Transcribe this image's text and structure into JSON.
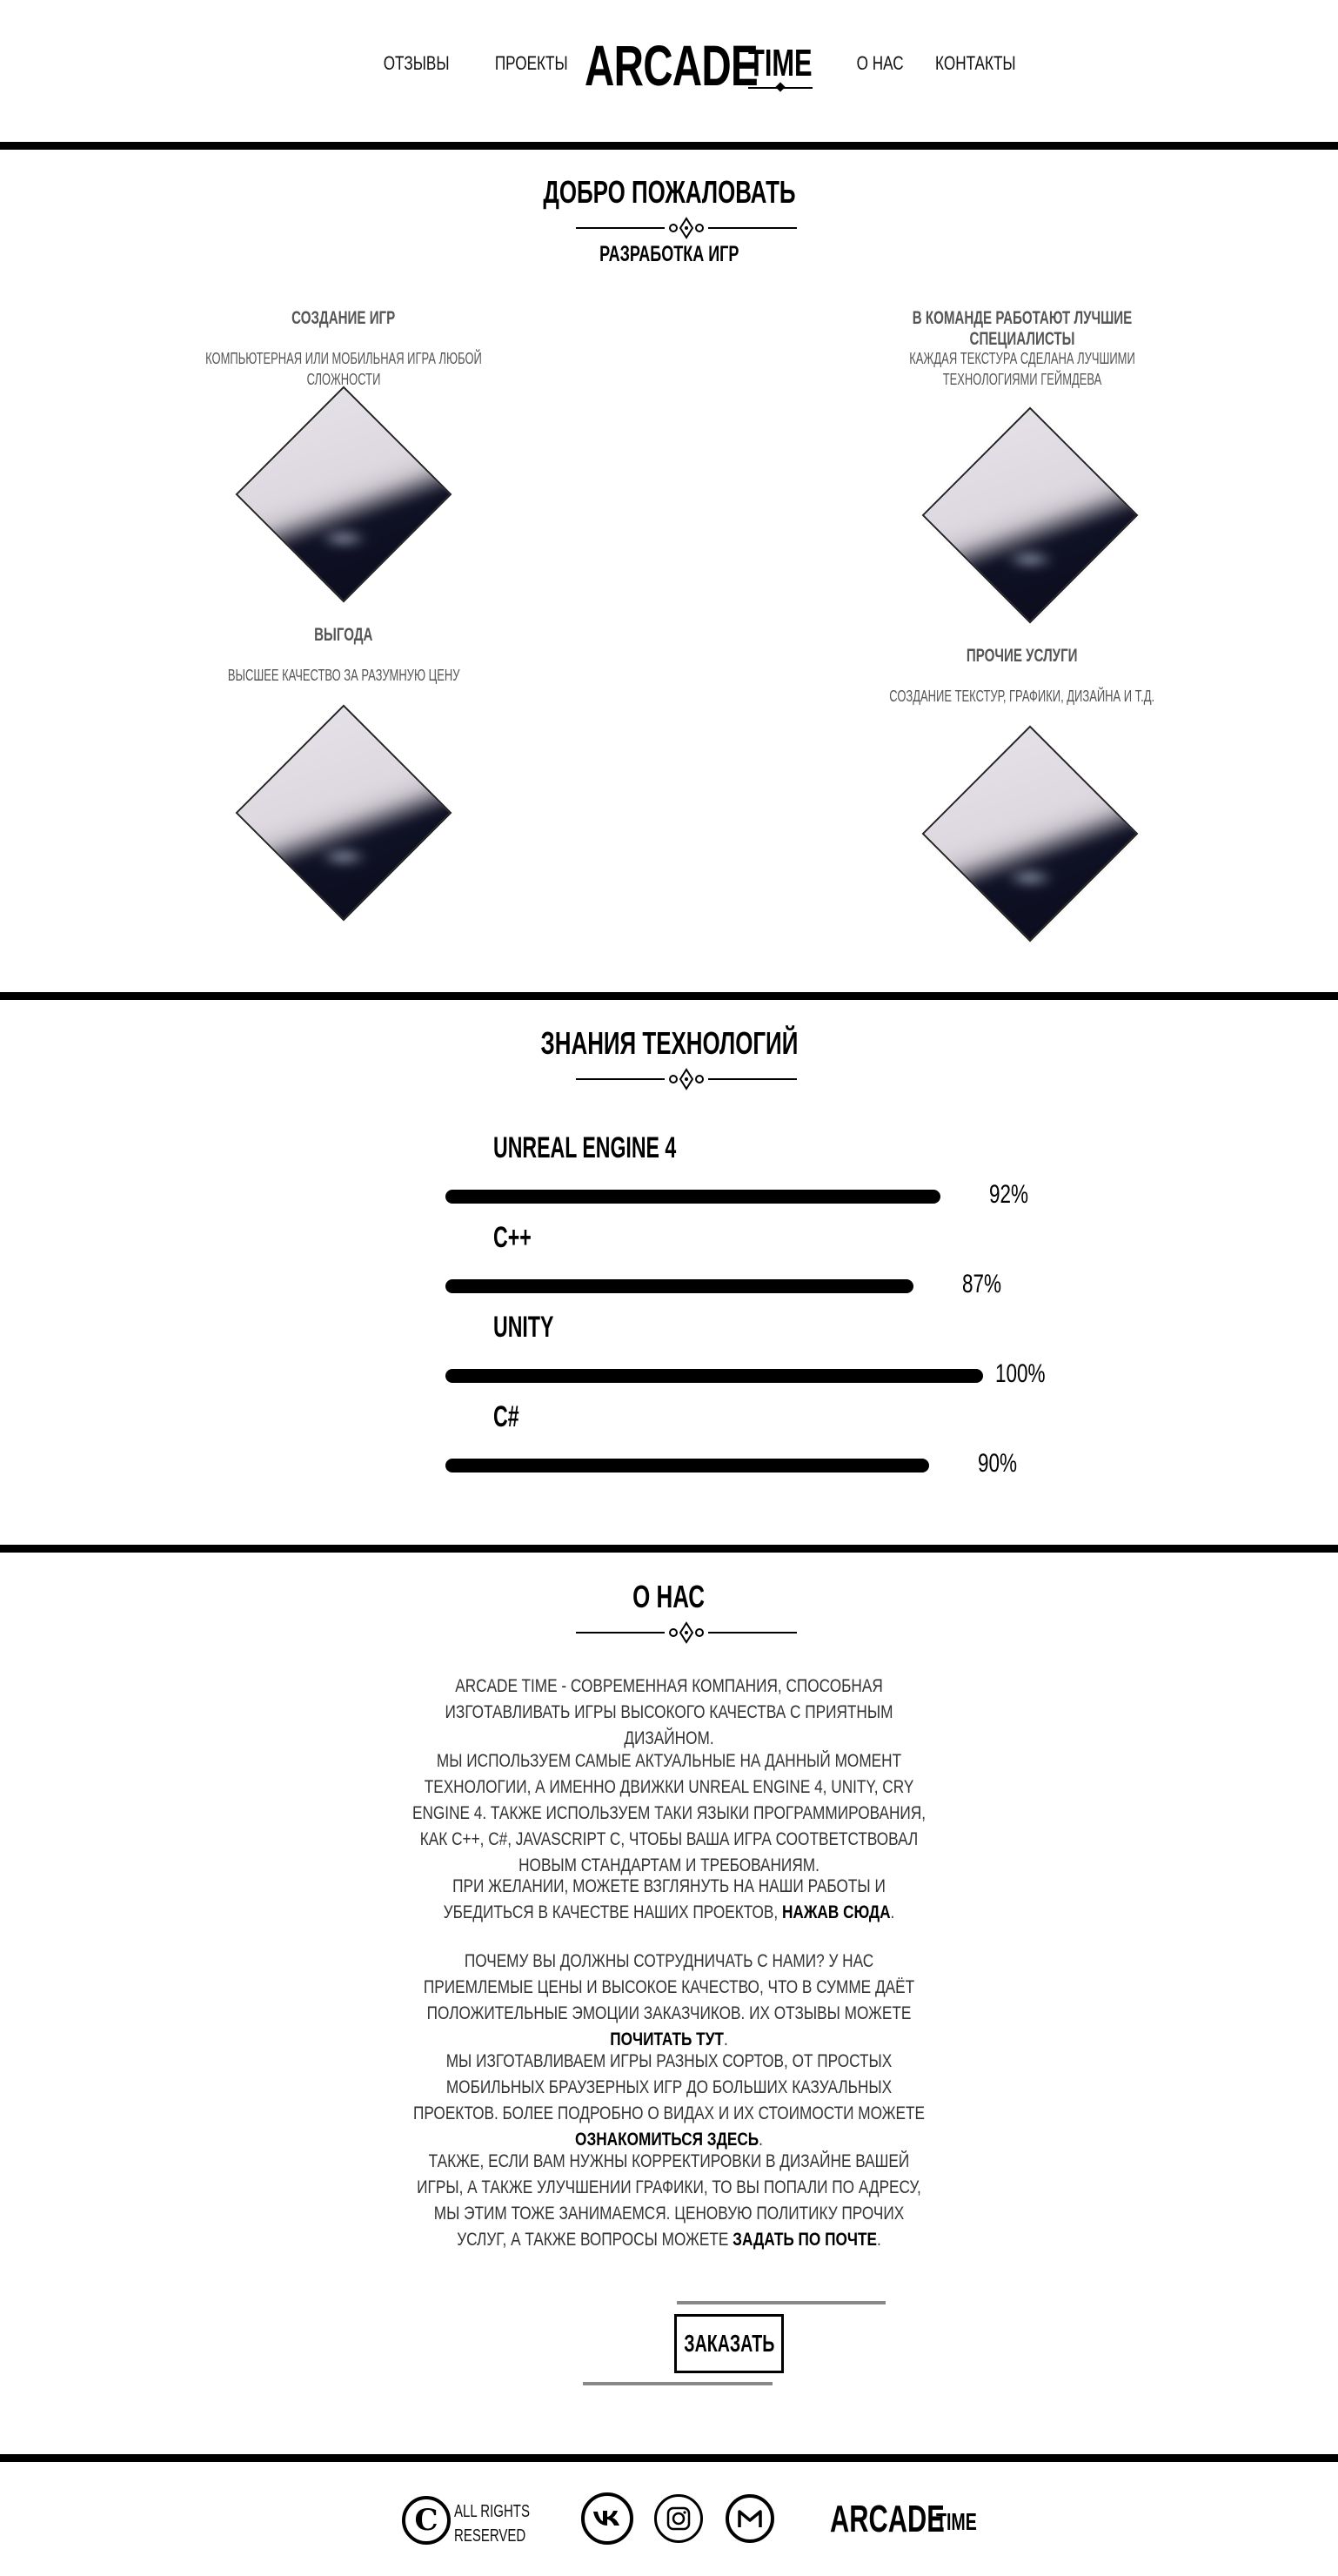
{
  "nav": {
    "reviews": "ОТЗЫВЫ",
    "projects": "ПРОЕКТЫ",
    "about": "О НАС",
    "contacts": "КОНТАКТЫ"
  },
  "logo": {
    "main": "ARCADE",
    "secondary": "TIME"
  },
  "welcome": {
    "title": "ДОБРО ПОЖАЛОВАТЬ",
    "subtitle": "РАЗРАБОТКА ИГР",
    "features": [
      {
        "title": "СОЗДАНИЕ ИГР",
        "desc": "КОМПЬЮТЕРНАЯ ИЛИ МОБИЛЬНАЯ ИГРА ЛЮБОЙ СЛОЖНОСТИ"
      },
      {
        "title": "В КОМАНДЕ РАБОТАЮТ ЛУЧШИЕ СПЕЦИАЛИСТЫ",
        "desc": "КАЖДАЯ ТЕКСТУРА СДЕЛАНА ЛУЧШИМИ ТЕХНОЛОГИЯМИ ГЕЙМДЕВА"
      },
      {
        "title": "ВЫГОДА",
        "desc": "ВЫСШЕЕ КАЧЕСТВО ЗА РАЗУМНУЮ ЦЕНУ"
      },
      {
        "title": "ПРОЧИЕ УСЛУГИ",
        "desc": "СОЗДАНИЕ ТЕКСТУР, ГРАФИКИ, ДИЗАЙНА И Т.Д."
      }
    ]
  },
  "skills": {
    "title": "ЗНАНИЯ ТЕХНОЛОГИЙ",
    "items": [
      {
        "name": "UNREAL ENGINE 4",
        "percent_label": "92%",
        "value": 92
      },
      {
        "name": "C++",
        "percent_label": "87%",
        "value": 87
      },
      {
        "name": "UNITY",
        "percent_label": "100%",
        "value": 100
      },
      {
        "name": "C#",
        "percent_label": "90%",
        "value": 90
      }
    ]
  },
  "about": {
    "title": "О НАС",
    "p1": "ARCADE TIME - СОВРЕМЕННАЯ КОМПАНИЯ, СПОСОБНАЯ ИЗГОТАВЛИВАТЬ ИГРЫ ВЫСОКОГО КАЧЕСТВА С ПРИЯТНЫМ ДИЗАЙНОМ.",
    "p2": "МЫ ИСПОЛЬЗУЕМ САМЫЕ АКТУАЛЬНЫЕ НА ДАННЫЙ МОМЕНТ ТЕХНОЛОГИИ, А ИМЕННО ДВИЖКИ UNREAL ENGINE 4, UNITY, CRY ENGINE 4. ТАКЖЕ ИСПОЛЬЗУЕМ ТАКИ ЯЗЫКИ ПРОГРАММИРОВАНИЯ, КАК C++, C#, JAVASCRIPT C, ЧТОБЫ ВАША ИГРА СООТВЕТСТВОВАЛ НОВЫМ СТАНДАРТАМ И ТРЕБОВАНИЯМ.",
    "p3_text": "ПРИ ЖЕЛАНИИ, МОЖЕТЕ ВЗГЛЯНУТЬ НА НАШИ РАБОТЫ И УБЕДИТЬСЯ В КАЧЕСТВЕ НАШИХ ПРОЕКТОВ, ",
    "p3_link": "НАЖАВ СЮДА",
    "p4_text": "ПОЧЕМУ ВЫ ДОЛЖНЫ СОТРУДНИЧАТЬ С НАМИ? У НАС ПРИЕМЛЕМЫЕ ЦЕНЫ И ВЫСОКОЕ КАЧЕСТВО, ЧТО В СУММЕ ДАЁТ ПОЛОЖИТЕЛЬНЫЕ ЭМОЦИИ ЗАКАЗЧИКОВ. ИХ ОТЗЫВЫ МОЖЕТЕ ",
    "p4_link": "ПОЧИТАТЬ ТУТ",
    "p5_text": "МЫ ИЗГОТАВЛИВАЕМ ИГРЫ РАЗНЫХ СОРТОВ, ОТ ПРОСТЫХ МОБИЛЬНЫХ БРАУЗЕРНЫХ ИГР ДО БОЛЬШИХ КАЗУАЛЬНЫХ ПРОЕКТОВ. БОЛЕЕ ПОДРОБНО О ВИДАХ И ИХ СТОИМОСТИ МОЖЕТЕ ",
    "p5_link": "ОЗНАКОМИТЬСЯ ЗДЕСЬ",
    "p6_text": "ТАКЖЕ, ЕСЛИ ВАМ НУЖНЫ КОРРЕКТИРОВКИ В ДИЗАЙНЕ ВАШЕЙ ИГРЫ, А ТАКЖЕ УЛУЧШЕНИИ ГРАФИКИ, ТО ВЫ ПОПАЛИ ПО АДРЕСУ, МЫ ЭТИМ ТОЖЕ ЗАНИМАЕМСЯ. ЦЕНОВУЮ ПОЛИТИКУ ПРОЧИХ УСЛУГ, А ТАКЖЕ ВОПРОСЫ МОЖЕТЕ ",
    "p6_link": "ЗАДАТЬ ПО ПОЧТЕ",
    "period": ".",
    "order_button": "ЗАКАЗАТЬ"
  },
  "footer": {
    "copyright_line1": "ALL RIGHTS",
    "copyright_line2": "RESERVED",
    "copyright_symbol": "C",
    "social": [
      "vk-icon",
      "instagram-icon",
      "gmail-icon"
    ],
    "logo_main": "ARCADE",
    "logo_secondary": "TIME"
  }
}
